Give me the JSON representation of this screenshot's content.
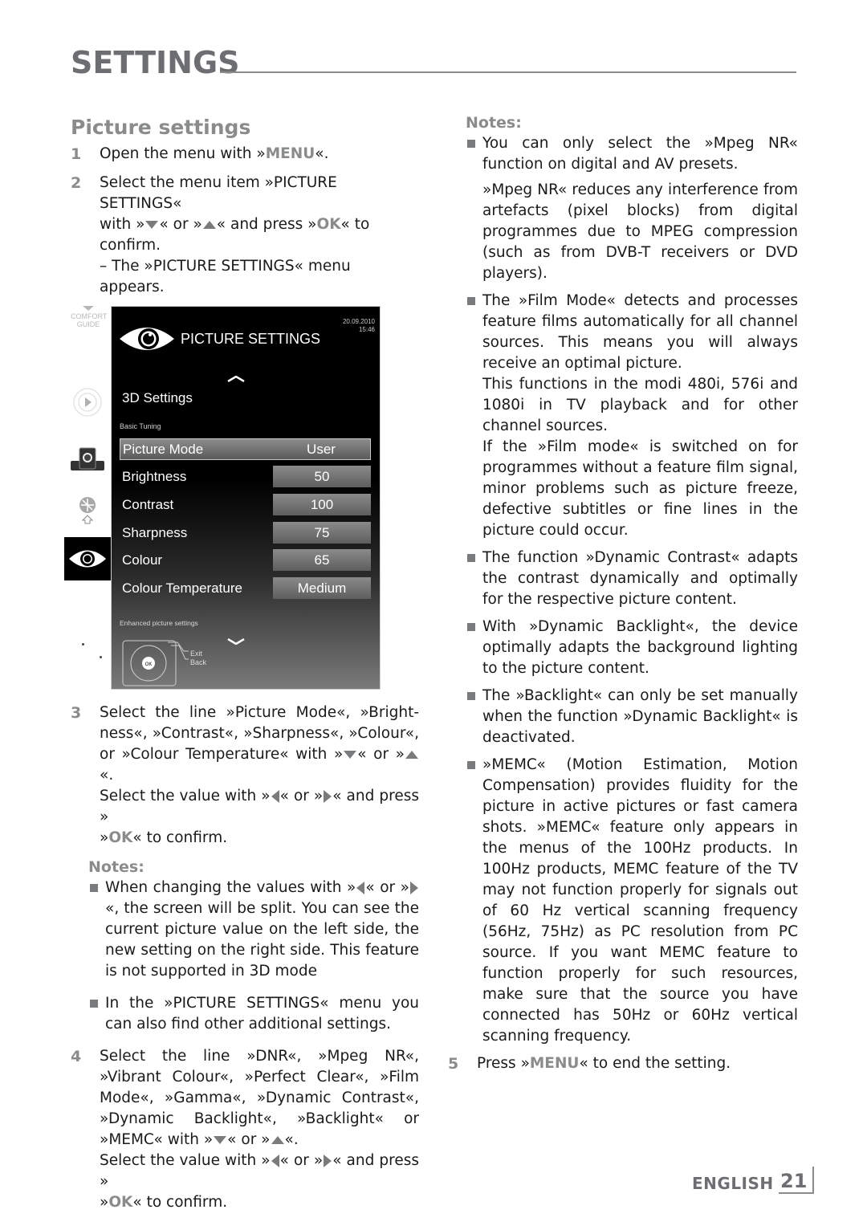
{
  "header": {
    "title": "SETTINGS"
  },
  "left": {
    "section_title": "Picture settings",
    "step1": {
      "num": "1",
      "pre": "Open the menu with »",
      "key": "MENU",
      "post": "«."
    },
    "step2": {
      "num": "2",
      "line1": "Select the menu item »PICTURE SETTINGS«",
      "with": "with »",
      "or": "« or »",
      "and_press": "« and press »",
      "ok": "OK",
      "confirm": "« to confirm.",
      "line3": "– The »PICTURE SETTINGS« menu appears."
    },
    "step3": {
      "num": "3",
      "line1": "Select the line »Picture Mode«, »Bright-ness«, »Contrast«, »Sharpness«, »Colour«, or »Colour Temperature« with »",
      "or": "« or »",
      "end": "«.",
      "line2": "Select the value with »",
      "and_press": "« and press »",
      "ok": "OK",
      "confirm": "« to confirm."
    },
    "notes_title": "Notes:",
    "notes": [
      {
        "pre": "When changing the values with »",
        "or": "« or »",
        "post": "«, the screen will be split. You can see the current picture value on the left side, the new setting on the right side. This feature is not supported in 3D mode"
      },
      {
        "text": "In the »PICTURE SETTINGS« menu you can also find other additional settings."
      }
    ],
    "step4": {
      "num": "4",
      "line1": "Select the line »DNR«, »Mpeg NR«, »Vibrant Colour«, »Perfect Clear«, »Film Mode«, »Gamma«, »Dynamic Contrast«, »Dynamic Backlight«, »Backlight« or »MEMC« with »",
      "or": "« or »",
      "end": "«.",
      "line2": "Select the value with »",
      "and_press": "« and press »",
      "ok": "OK",
      "confirm": "« to confirm."
    }
  },
  "tv_menu": {
    "comfort_guide": [
      "COMFORT",
      "GUIDE"
    ],
    "date": "20.09.2010",
    "time": "15:46",
    "title": "PICTURE SETTINGS",
    "item_3d": "3D Settings",
    "basic_tuning": "Basic Tuning",
    "rows": [
      {
        "label": "Picture Mode",
        "value": "User",
        "selected": true
      },
      {
        "label": "Brightness",
        "value": "50"
      },
      {
        "label": "Contrast",
        "value": "100"
      },
      {
        "label": "Sharpness",
        "value": "75"
      },
      {
        "label": "Colour",
        "value": "65"
      },
      {
        "label": "Colour Temperature",
        "value": "Medium"
      }
    ],
    "enhanced": "Enhanced picture settings",
    "ok_label": "OK",
    "exit": "Exit",
    "back": "Back"
  },
  "right": {
    "notes_title": "Notes:",
    "notes": [
      {
        "paras": [
          "You can only select the »Mpeg NR« function on digital and AV presets.",
          "»Mpeg NR«  reduces any interference from artefacts (pixel blocks) from digital programmes due to MPEG compression (such as from DVB-T receivers or DVD players)."
        ]
      },
      {
        "paras": [
          "The »Film Mode« detects and processes feature films automatically for all channel sources. This means you will always receive an optimal picture.",
          "This functions in the modi 480i, 576i and 1080i in TV playback and for other channel sources.",
          "If the »Film mode« is switched on for programmes without a feature film signal, minor problems such as picture freeze, defective subtitles or fine lines in the picture could occur."
        ]
      },
      {
        "paras": [
          "The function »Dynamic Contrast« adapts the contrast dynamically and optimally for the respective picture content."
        ]
      },
      {
        "paras": [
          "With »Dynamic Backlight«, the device optimally adapts the background lighting to the picture content."
        ]
      },
      {
        "paras": [
          "The »Backlight« can only be set manually when the function »Dynamic Backlight« is deactivated."
        ]
      },
      {
        "paras": [
          "»MEMC« (Motion Estimation, Motion Compensation) provides fluidity for the picture in active pictures or fast camera shots. »MEMC« feature only appears in the menus of the 100Hz products. In 100Hz products, MEMC feature of the TV may not function properly for signals out of 60 Hz vertical scanning frequency (56Hz, 75Hz) as PC resolution from PC source. If you want MEMC feature to function properly for such resources, make sure that the source you have connected has 50Hz or 60Hz vertical scanning frequency."
        ]
      }
    ],
    "step5": {
      "num": "5",
      "pre": "Press »",
      "key": "MENU",
      "post": "« to end the setting."
    }
  },
  "footer": {
    "language": "ENGLISH",
    "page": "21"
  }
}
